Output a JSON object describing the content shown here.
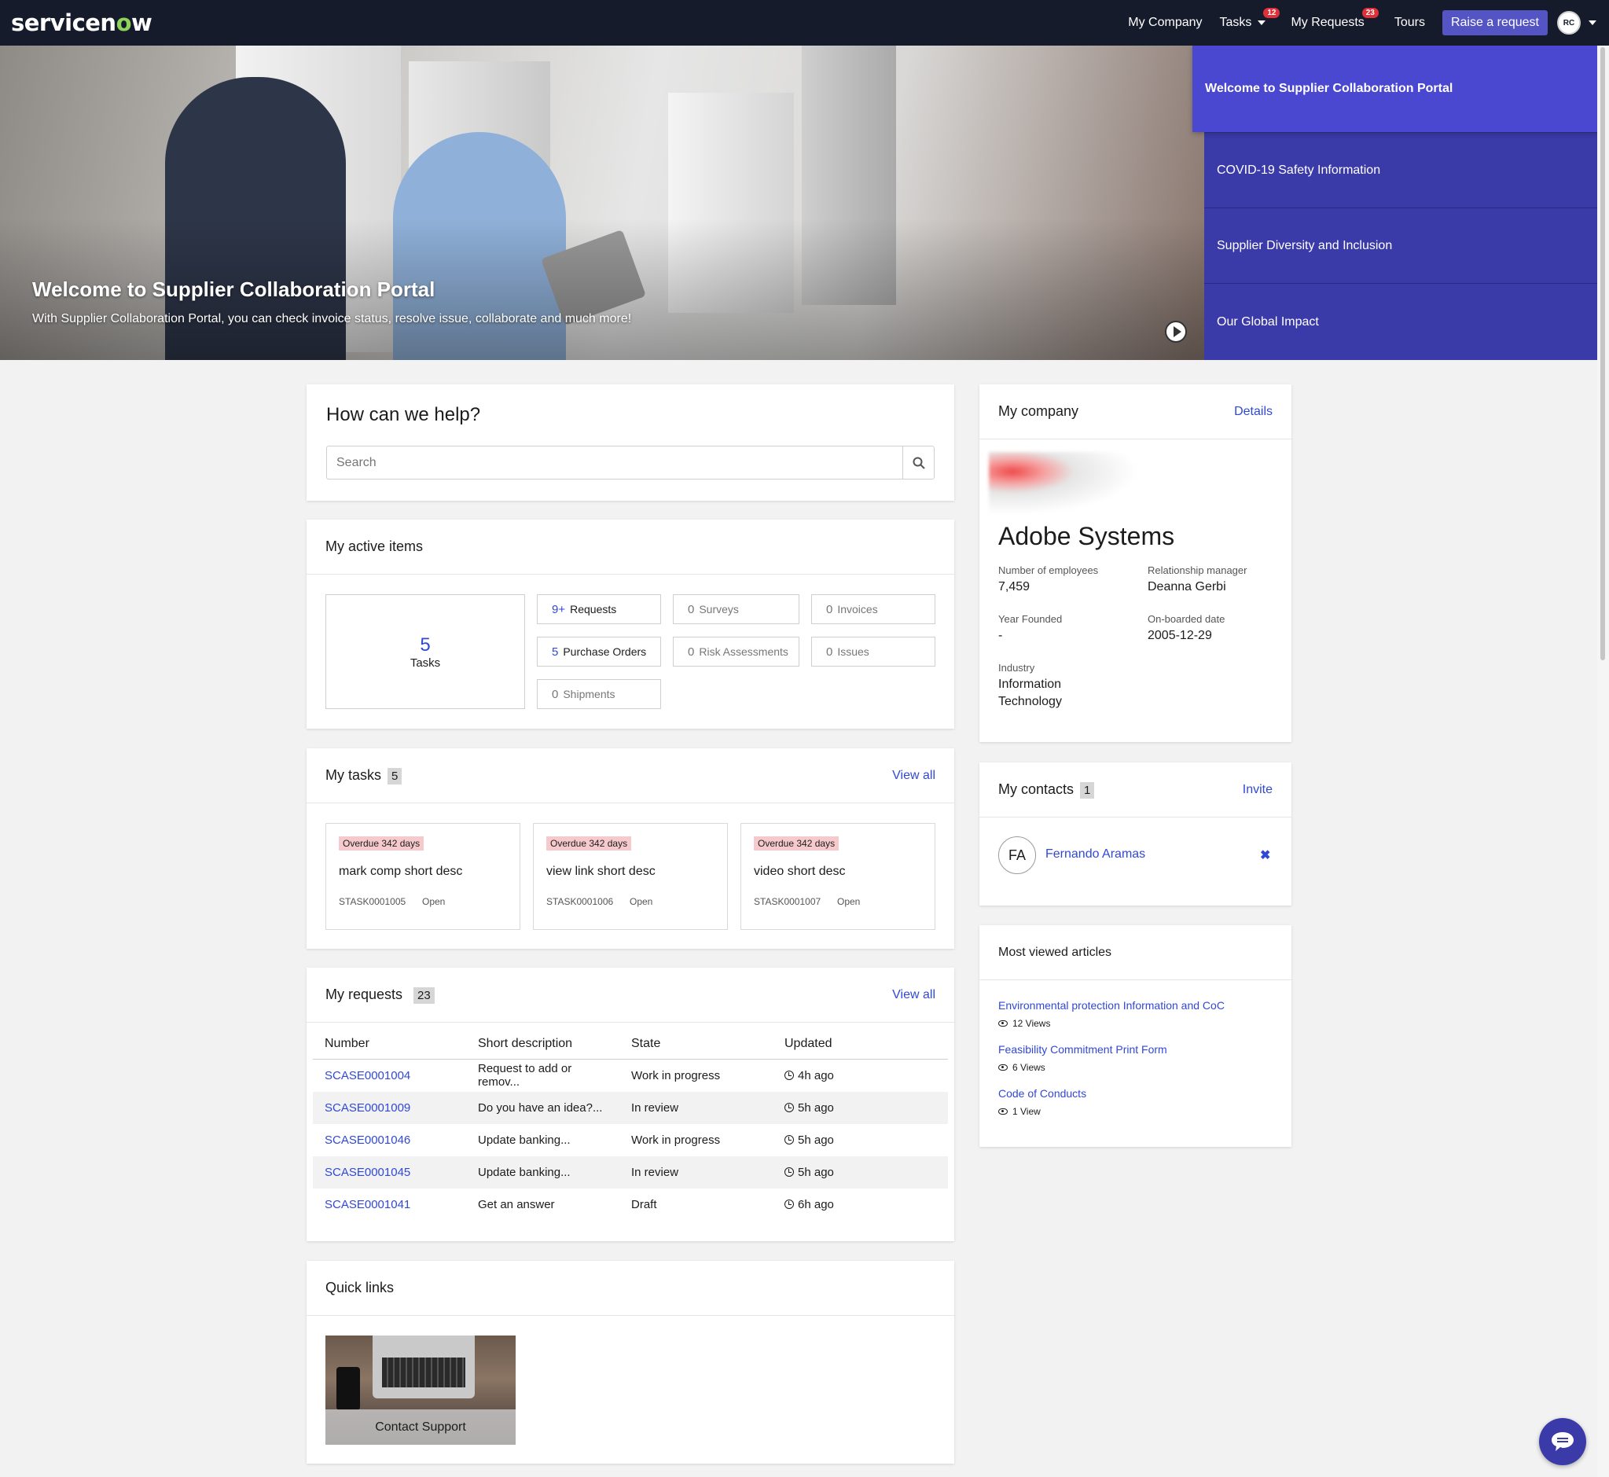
{
  "nav": {
    "logo_pre": "servicen",
    "logo_o": "o",
    "logo_post": "w",
    "my_company": "My Company",
    "tasks": "Tasks",
    "tasks_badge": "12",
    "my_requests": "My Requests",
    "requests_badge": "23",
    "tours": "Tours",
    "raise_request": "Raise a request",
    "avatar_initials": "RC"
  },
  "hero": {
    "title": "Welcome to Supplier Collaboration Portal",
    "subtitle": "With Supplier Collaboration Portal, you can check invoice status, resolve issue, collaborate and much more!",
    "menu": [
      "Welcome to Supplier Collaboration Portal",
      "COVID-19 Safety Information",
      "Supplier Diversity and Inclusion",
      "Our Global Impact"
    ]
  },
  "help": {
    "title": "How can we help?",
    "search_placeholder": "Search"
  },
  "active_items": {
    "title": "My active items",
    "tasks_count": "5",
    "tasks_label": "Tasks",
    "chips": {
      "requests": {
        "n": "9+",
        "label": "Requests"
      },
      "surveys": {
        "n": "0",
        "label": "Surveys"
      },
      "invoices": {
        "n": "0",
        "label": "Invoices"
      },
      "purchase_orders": {
        "n": "5",
        "label": "Purchase Orders"
      },
      "risk_assessments": {
        "n": "0",
        "label": "Risk Assessments"
      },
      "issues": {
        "n": "0",
        "label": "Issues"
      },
      "shipments": {
        "n": "0",
        "label": "Shipments"
      }
    }
  },
  "my_tasks": {
    "title": "My tasks",
    "count": "5",
    "view_all": "View all",
    "items": [
      {
        "overdue": "Overdue 342 days",
        "desc": "mark comp short desc",
        "number": "STASK0001005",
        "state": "Open"
      },
      {
        "overdue": "Overdue 342 days",
        "desc": "view link short desc",
        "number": "STASK0001006",
        "state": "Open"
      },
      {
        "overdue": "Overdue 342 days",
        "desc": "video short desc",
        "number": "STASK0001007",
        "state": "Open"
      }
    ]
  },
  "my_requests": {
    "title": "My requests",
    "count": "23",
    "view_all": "View all",
    "columns": [
      "Number",
      "Short description",
      "State",
      "Updated"
    ],
    "rows": [
      {
        "number": "SCASE0001004",
        "desc": "Request to add or remov...",
        "state": "Work in progress",
        "updated": "4h ago"
      },
      {
        "number": "SCASE0001009",
        "desc": "Do you have an idea?...",
        "state": "In review",
        "updated": "5h ago"
      },
      {
        "number": "SCASE0001046",
        "desc": "Update banking...",
        "state": "Work in progress",
        "updated": "5h ago"
      },
      {
        "number": "SCASE0001045",
        "desc": "Update banking...",
        "state": "In review",
        "updated": "5h ago"
      },
      {
        "number": "SCASE0001041",
        "desc": "Get an answer",
        "state": "Draft",
        "updated": "6h ago"
      }
    ]
  },
  "quick_links": {
    "title": "Quick links",
    "tile_label": "Contact Support"
  },
  "company": {
    "title": "My company",
    "details": "Details",
    "name": "Adobe Systems",
    "employees_label": "Number of employees",
    "employees": "7,459",
    "manager_label": "Relationship manager",
    "manager": "Deanna Gerbi",
    "founded_label": "Year Founded",
    "founded": "-",
    "onboarded_label": "On-boarded date",
    "onboarded": "2005-12-29",
    "industry_label": "Industry",
    "industry_line1": "Information",
    "industry_line2": "Technology"
  },
  "contacts": {
    "title": "My contacts",
    "count": "1",
    "invite": "Invite",
    "items": [
      {
        "initials": "FA",
        "name": "Fernando Aramas",
        "remove": "✖"
      }
    ]
  },
  "articles": {
    "title": "Most viewed articles",
    "items": [
      {
        "title": "Environmental protection Information and CoC",
        "views": "12 Views"
      },
      {
        "title": "Feasibility Commitment Print Form",
        "views": "6 Views"
      },
      {
        "title": "Code of Conducts",
        "views": "1 View"
      }
    ]
  },
  "colors": {
    "nav_bg": "#161b2b",
    "accent": "#5454c4",
    "link": "#3148d4",
    "hero_menu": "#3a3aa8",
    "overdue_bg": "#f6c9cc"
  }
}
